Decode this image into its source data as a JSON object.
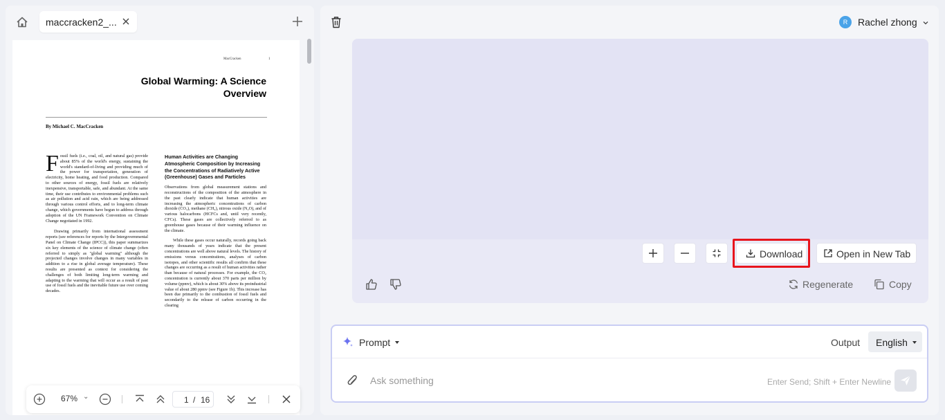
{
  "left_panel": {
    "tab": {
      "label": "maccracken2_...",
      "close_icon": "close-icon"
    },
    "icons": {
      "home": "home-icon",
      "add_tab": "plus-icon"
    },
    "document": {
      "running_header": "MacCracken",
      "page_number": "1",
      "title": "Global Warming: A Science Overview",
      "author": "By Michael C. MacCracken",
      "dropcap": "F",
      "col_left_p1": "ossil fuels (i.e., coal, oil, and natural gas) provide about 85% of the world's energy, sustaining the world's standard-of-living and providing much of the power for transportation, generation of electricity, home heating, and food production. Compared to other sources of energy, fossil fuels are relatively inexpensive, transportable, safe, and abundant. At the same time, their use contributes to environmental problems such as air pollution and acid rain, which are being addressed through various control efforts, and to long-term climate change, which governments have begun to address through adoption of the UN Framework Convention on Climate Change negotiated in 1992.",
      "col_left_p2": "Drawing primarily from international assessment reports (see references for reports by the Intergovernmental Panel on Climate Change (IPCC)), this paper summarizes six key elements of the science of climate change (often referred to simply as \"global warming\" although the projected changes involve changes in many variables in addition to a rise in global average temperature). These results are presented as context for considering the challenges of both limiting long-term warming and adapting to the warming that will occur as a result of past use of fossil fuels and the inevitable future use over coming decades.",
      "col_right_heading": "Human Activities are Changing Atmospheric Composition by Increasing the Concentrations of Radiatively Active (Greenhouse) Gases and Particles",
      "col_right_p1": "Observations from global measurement stations and reconstructions of the composition of the atmosphere in the past clearly indicate that human activities are increasing the atmospheric concentrations of carbon dioxide (CO₂), methane (CH₄), nitrous oxide (N₂O), and of various halocarbons (HCFCs and, until very recently, CFCs). These gases are collectively referred to as greenhouse gases because of their warming influence on the climate.",
      "col_right_p2": "While these gases occur naturally, records going back many thousands of years indicate that the present concentrations are well above natural levels. The history of emissions versus concentrations, analyses of carbon isotopes, and other scientific results all confirm that these changes are occurring as a result of human activities rather than because of natural processes. For example, the CO₂ concentration is currently about 370 parts per million by volume (ppmv), which is about 30% above its preindustrial value of about 280 ppmv (see Figure 1b). This increase has been due primarily to the combustion of fossil fuels and secondarily to the release of carbon occurring in the clearing"
    },
    "toolbar": {
      "zoom": "67%",
      "zoom_caret": "⌄",
      "current_page": "1",
      "page_separator": "/",
      "total_pages": "16",
      "icons": [
        "zoom-in-icon",
        "zoom-out-icon",
        "first-page-icon",
        "previous-page-icon",
        "next-page-icon",
        "last-page-icon",
        "close-icon"
      ]
    }
  },
  "right_panel": {
    "user": {
      "initial": "R",
      "name": "Rachel zhong",
      "avatar_color": "#4aa3e8"
    },
    "controls": {
      "download_label": "Download",
      "open_new_tab_label": "Open in New Tab",
      "highlight_color": "#e8141c"
    },
    "actions": {
      "regenerate_label": "Regenerate",
      "copy_label": "Copy"
    },
    "prompt": {
      "label": "Prompt",
      "output_label": "Output",
      "output_value": "English",
      "placeholder": "Ask something",
      "send_hint": "Enter Send; Shift + Enter Newline"
    },
    "colors": {
      "preview_bg": "#e3e3f4",
      "prompt_border": "#c9cdf4",
      "sparkle": "#6b72f0"
    }
  }
}
